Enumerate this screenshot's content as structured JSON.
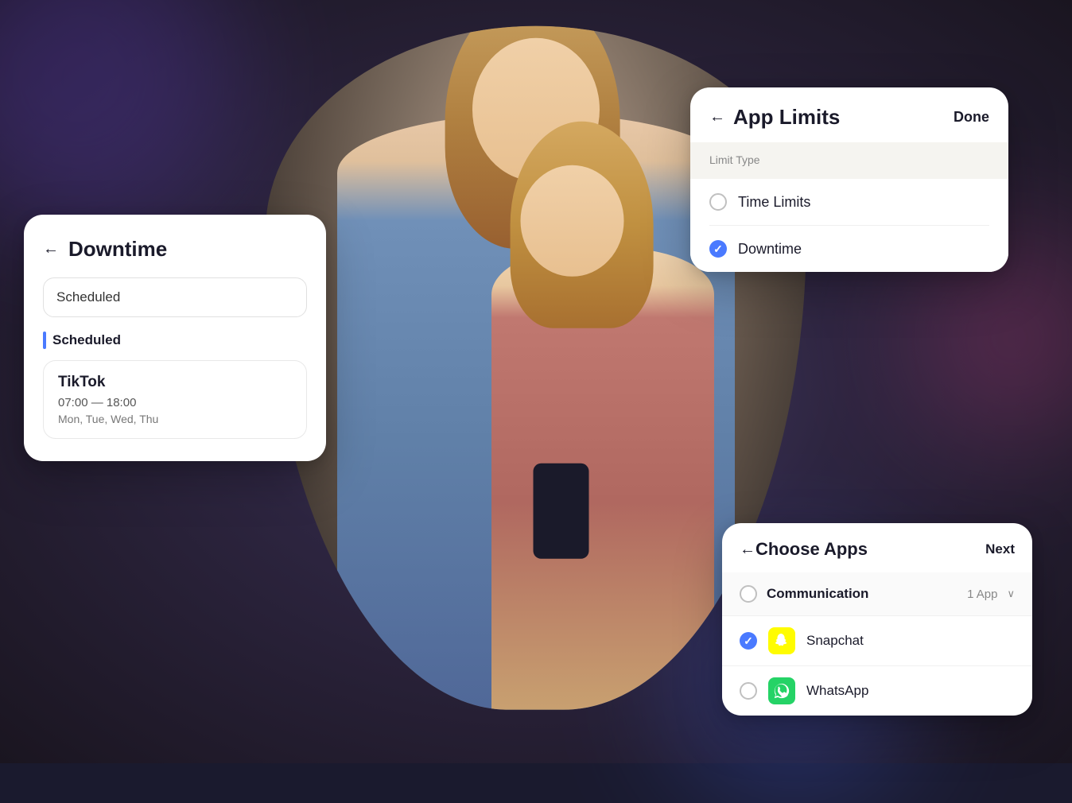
{
  "background": {
    "color": "#1a1520"
  },
  "downtime_card": {
    "back_arrow": "←",
    "title": "Downtime",
    "input_placeholder": "Scheduled",
    "section_label": "Scheduled",
    "tiktok": {
      "name": "TikTok",
      "time": "07:00 — 18:00",
      "days": "Mon, Tue, Wed, Thu"
    }
  },
  "app_limits_card": {
    "back_arrow": "←",
    "title": "App Limits",
    "done_label": "Done",
    "limit_type_label": "Limit Type",
    "options": [
      {
        "label": "Time Limits",
        "checked": false
      },
      {
        "label": "Downtime",
        "checked": true
      }
    ]
  },
  "choose_apps_card": {
    "back_arrow": "←",
    "title": "Choose Apps",
    "next_label": "Next",
    "category": {
      "label": "Communication",
      "count": "1 App"
    },
    "apps": [
      {
        "name": "Snapchat",
        "icon_type": "snapchat",
        "checked": true
      },
      {
        "name": "WhatsApp",
        "icon_type": "whatsapp",
        "checked": false
      }
    ]
  }
}
